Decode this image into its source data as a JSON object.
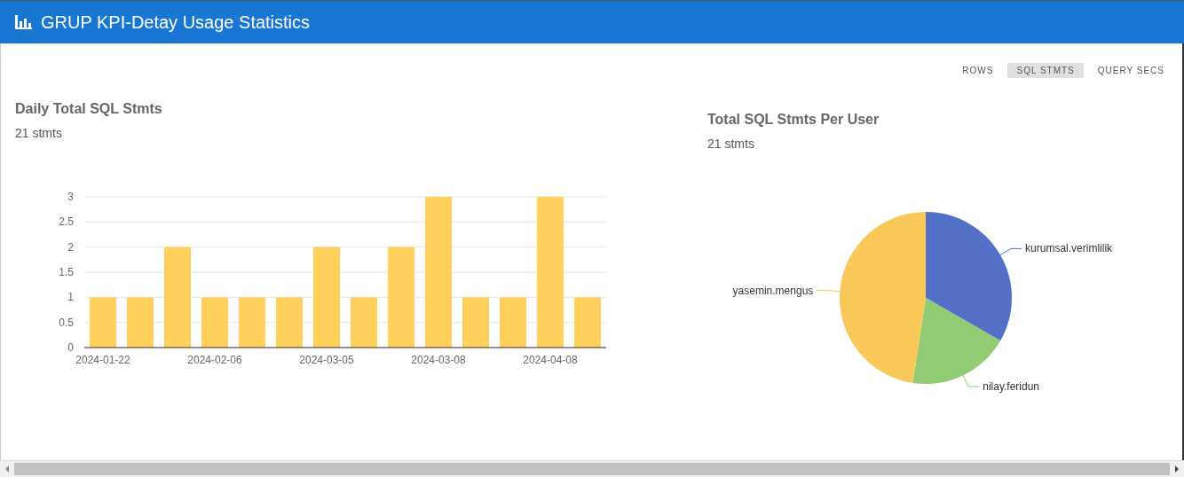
{
  "header": {
    "title": "GRUP KPI-Detay Usage Statistics"
  },
  "tabs": [
    {
      "label": "ROWS",
      "selected": false
    },
    {
      "label": "SQL STMTS",
      "selected": true
    },
    {
      "label": "QUERY SECS",
      "selected": false
    }
  ],
  "daily_panel": {
    "title": "Daily Total SQL Stmts",
    "subtitle": "21 stmts",
    "chart_data": {
      "type": "bar",
      "categories": [
        "2024-01-22",
        null,
        null,
        "2024-02-06",
        null,
        null,
        "2024-03-05",
        null,
        null,
        "2024-03-08",
        null,
        null,
        "2024-04-08",
        null
      ],
      "values": [
        1,
        1,
        2,
        1,
        1,
        1,
        2,
        1,
        2,
        3,
        1,
        1,
        3,
        1
      ],
      "color": "#ffd05c",
      "grid": true,
      "ylim": [
        0,
        3
      ],
      "yticks": [
        0,
        0.5,
        1,
        1.5,
        2,
        2.5,
        3
      ]
    }
  },
  "user_panel": {
    "title": "Total SQL Stmts Per User",
    "subtitle": "21 stmts",
    "chart_data": {
      "type": "pie",
      "categories": [
        "kurumsal.verimlilik",
        "nilay.feridun",
        "yasemin.mengus"
      ],
      "values": [
        33.3,
        19.1,
        47.6
      ],
      "colors": [
        "#5470c6",
        "#91cc75",
        "#fac858"
      ]
    }
  }
}
